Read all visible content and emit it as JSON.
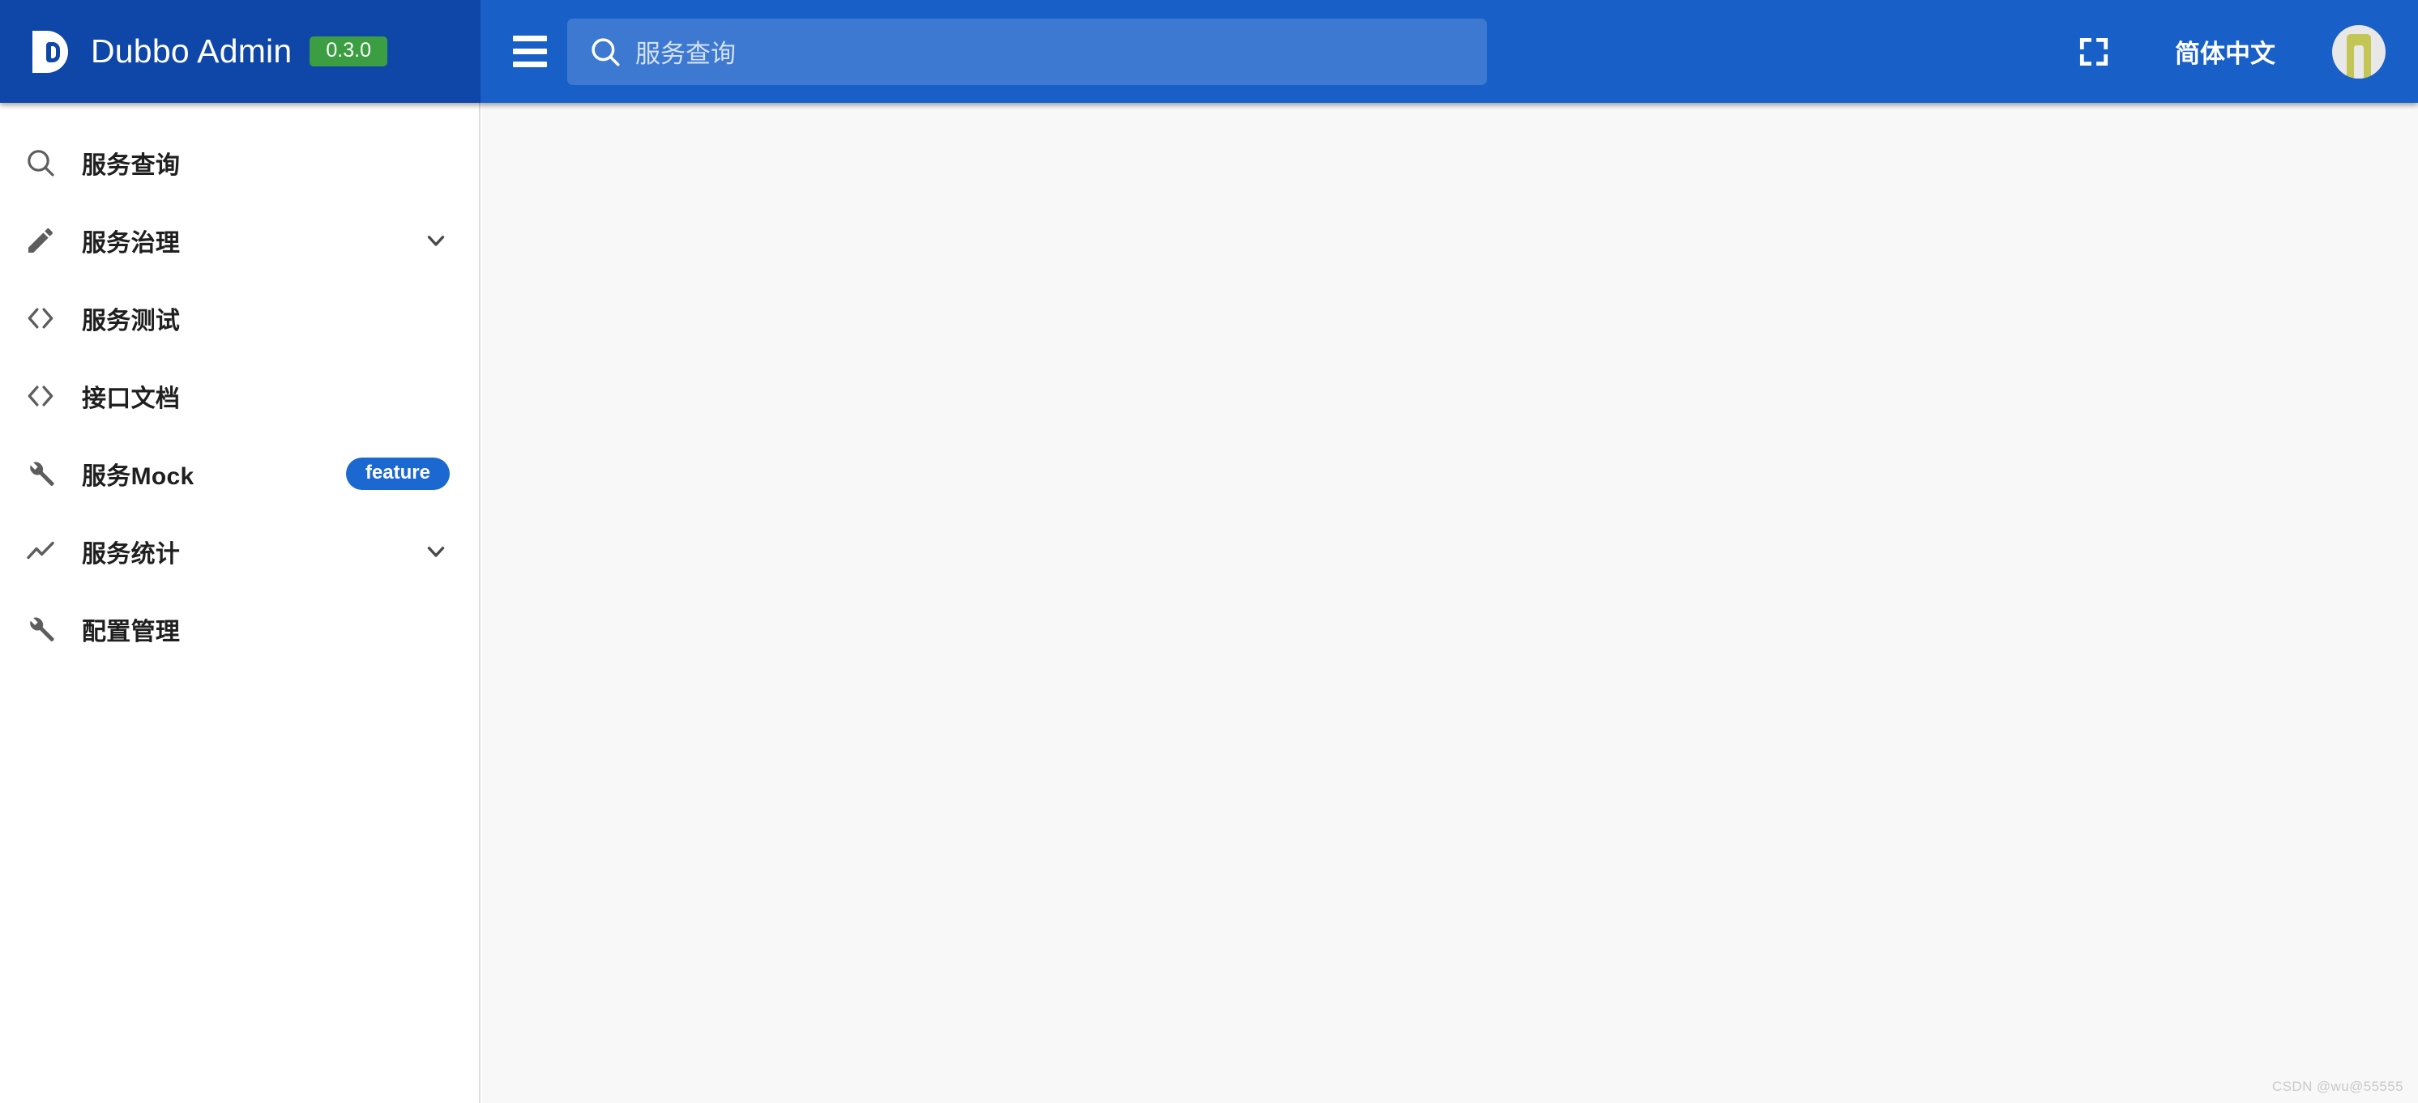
{
  "header": {
    "brand": {
      "logo_icon": "dubbo-d-logo-icon",
      "title": "Dubbo Admin",
      "version": "0.3.0",
      "version_bg": "#3c9e42",
      "brand_bg": "#0f47a8"
    },
    "menu_toggle_icon": "hamburger-menu-icon",
    "search": {
      "icon": "search-icon",
      "placeholder": "服务查询",
      "value": ""
    },
    "fullscreen_icon": "fullscreen-expand-icon",
    "language_label": "简体中文",
    "avatar_icon": "user-avatar-icon",
    "background": "#1860c8"
  },
  "sidebar": {
    "background": "#ffffff",
    "items": [
      {
        "label": "服务查询",
        "icon": "search-icon",
        "has_chevron": false,
        "badge": null
      },
      {
        "label": "服务治理",
        "icon": "pencil-edit-icon",
        "has_chevron": true,
        "badge": null
      },
      {
        "label": "服务测试",
        "icon": "code-brackets-icon",
        "has_chevron": false,
        "badge": null
      },
      {
        "label": "接口文档",
        "icon": "code-brackets-icon",
        "has_chevron": false,
        "badge": null
      },
      {
        "label": "服务Mock",
        "icon": "wrench-icon",
        "has_chevron": false,
        "badge": "feature"
      },
      {
        "label": "服务统计",
        "icon": "trending-chart-icon",
        "has_chevron": true,
        "badge": null
      },
      {
        "label": "配置管理",
        "icon": "wrench-icon",
        "has_chevron": false,
        "badge": null
      }
    ],
    "badge_color": "#1b68d0",
    "chevron_icon": "chevron-down-icon"
  },
  "main": {
    "background": "#f8f8f8",
    "content": ""
  },
  "watermark": {
    "text": "CSDN @wu@55555"
  }
}
